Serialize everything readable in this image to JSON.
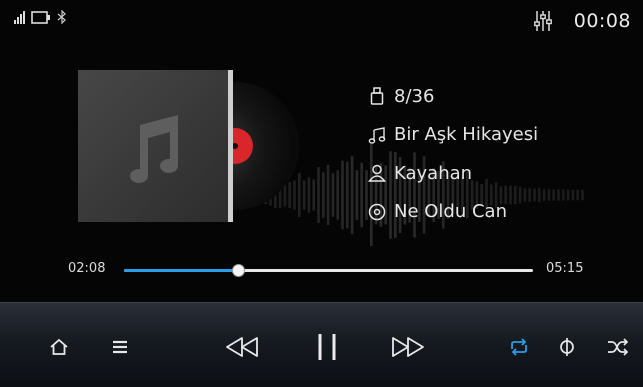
{
  "status": {
    "time": "00:08",
    "icons": [
      "signal-icon",
      "battery-icon",
      "bluetooth-icon",
      "equalizer-icon"
    ]
  },
  "track": {
    "counter": "8/36",
    "title": "Bir Aşk Hikayesi",
    "artist": "Kayahan",
    "album": "Ne Oldu Can"
  },
  "progress": {
    "elapsed": "02:08",
    "total": "05:15",
    "fraction": 0.279
  },
  "controls": {
    "icons": [
      "home-icon",
      "list-icon",
      "previous-icon",
      "pause-icon",
      "next-icon",
      "repeat-icon",
      "shuffle-order-icon",
      "shuffle-icon"
    ],
    "active_color": "#2a9ee6"
  },
  "colors": {
    "accent": "#2a9ee6",
    "background": "#050505",
    "disc_label": "#d8262b"
  }
}
